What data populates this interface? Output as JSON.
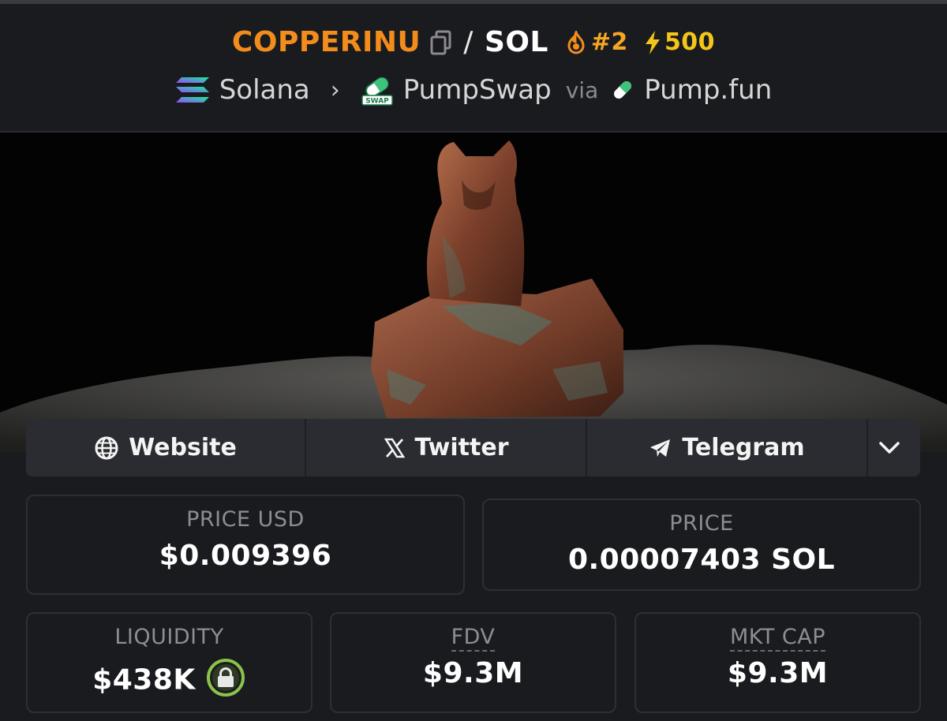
{
  "header": {
    "token_symbol": "COPPERINU",
    "separator": "/",
    "quote_symbol": "SOL",
    "trending_rank": "#2",
    "boost_count": "500",
    "chain": "Solana",
    "dex": "PumpSwap",
    "via_label": "via",
    "launchpad": "Pump.fun"
  },
  "links": {
    "website": "Website",
    "twitter": "Twitter",
    "telegram": "Telegram"
  },
  "stats": {
    "price_usd_label": "PRICE USD",
    "price_usd": "$0.009396",
    "price_label": "PRICE",
    "price_native": "0.00007403 SOL",
    "liquidity_label": "LIQUIDITY",
    "liquidity": "$438K",
    "fdv_label": "FDV",
    "fdv": "$9.3M",
    "mktcap_label": "MKT CAP",
    "mktcap": "$9.3M"
  },
  "colors": {
    "token": "#f28c1c",
    "rank": "#f5a623",
    "boost": "#f5c518",
    "lock_ring": "#8bc34a"
  },
  "icons": [
    "copy-icon",
    "fire-icon",
    "lightning-icon",
    "solana-logo-icon",
    "chevron-right-icon",
    "pumpswap-logo-icon",
    "pill-icon",
    "globe-icon",
    "x-logo-icon",
    "telegram-icon",
    "chevron-down-icon",
    "lock-icon"
  ]
}
